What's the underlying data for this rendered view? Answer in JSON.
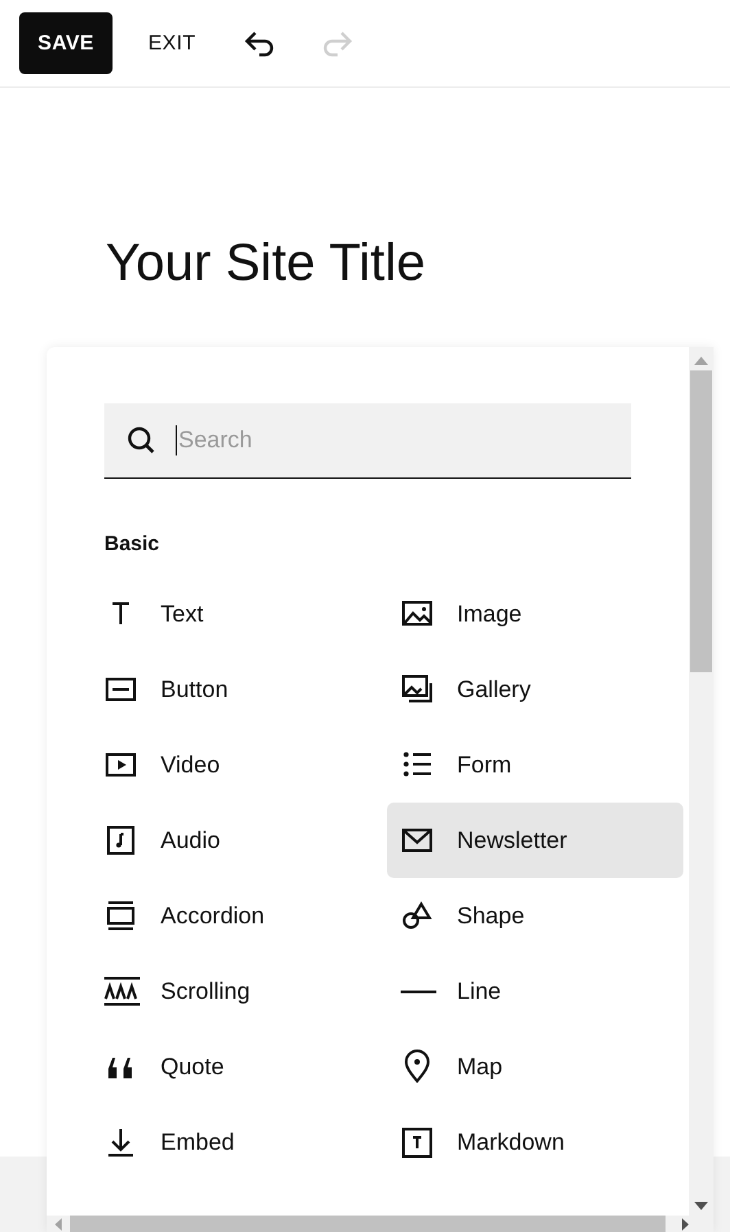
{
  "toolbar": {
    "save": "SAVE",
    "exit": "EXIT",
    "undo": {
      "disabled": false
    },
    "redo": {
      "disabled": true
    }
  },
  "site_title": "Your Site Title",
  "block_picker": {
    "search": {
      "placeholder": "Search"
    },
    "section": "Basic",
    "items": [
      {
        "kind": "text",
        "label": "Text",
        "selected": false
      },
      {
        "kind": "image",
        "label": "Image",
        "selected": false
      },
      {
        "kind": "button",
        "label": "Button",
        "selected": false
      },
      {
        "kind": "gallery",
        "label": "Gallery",
        "selected": false
      },
      {
        "kind": "video",
        "label": "Video",
        "selected": false
      },
      {
        "kind": "form",
        "label": "Form",
        "selected": false
      },
      {
        "kind": "audio",
        "label": "Audio",
        "selected": false
      },
      {
        "kind": "newsletter",
        "label": "Newsletter",
        "selected": true
      },
      {
        "kind": "accordion",
        "label": "Accordion",
        "selected": false
      },
      {
        "kind": "shape",
        "label": "Shape",
        "selected": false
      },
      {
        "kind": "scrolling",
        "label": "Scrolling",
        "selected": false
      },
      {
        "kind": "line",
        "label": "Line",
        "selected": false
      },
      {
        "kind": "quote",
        "label": "Quote",
        "selected": false
      },
      {
        "kind": "map",
        "label": "Map",
        "selected": false
      },
      {
        "kind": "embed",
        "label": "Embed",
        "selected": false
      },
      {
        "kind": "markdown",
        "label": "Markdown",
        "selected": false
      }
    ]
  }
}
